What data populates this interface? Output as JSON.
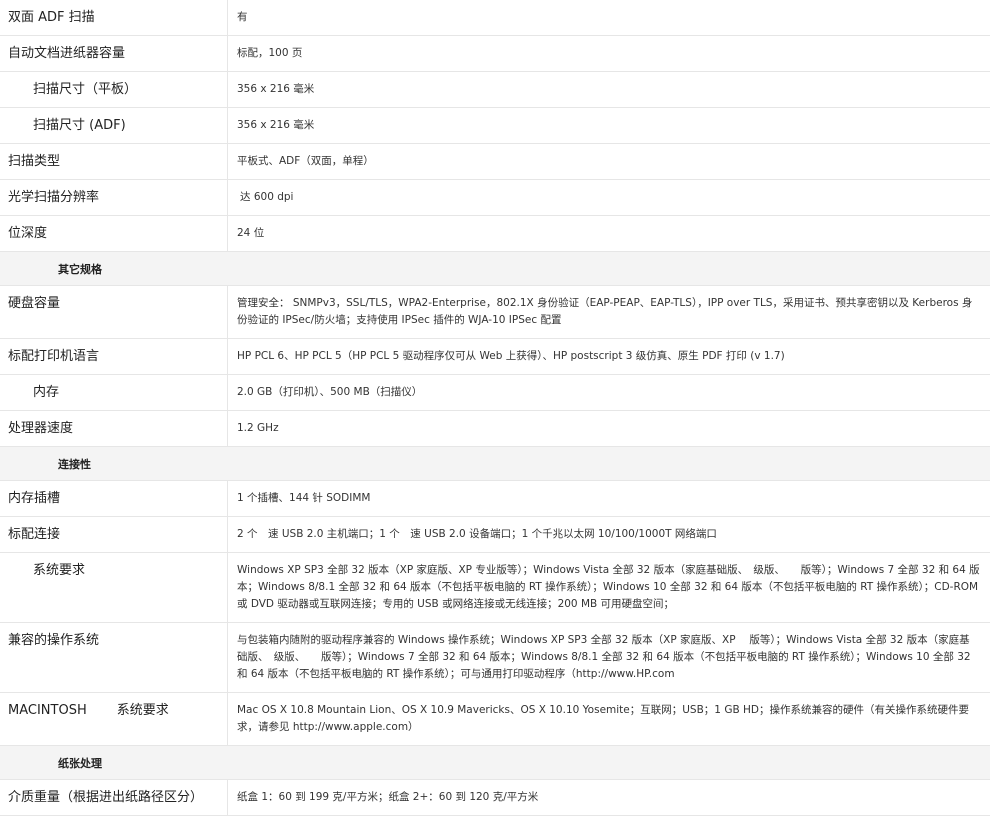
{
  "rows": [
    {
      "type": "spec",
      "label": "双面 ADF 扫描",
      "value": "有"
    },
    {
      "type": "spec",
      "label": "自动文档进纸器容量",
      "value": "标配，100 页"
    },
    {
      "type": "spec",
      "label": "扫描尺寸（平板）",
      "value": "356 x 216 毫米",
      "indent": true
    },
    {
      "type": "spec",
      "label": "扫描尺寸 (ADF)",
      "value": "356 x 216 毫米",
      "indent": true
    },
    {
      "type": "spec",
      "label": "扫描类型",
      "value": "平板式、ADF（双面，单程）"
    },
    {
      "type": "spec",
      "label": "光学扫描分辨率",
      "value": "达 600 dpi",
      "value_indent": true
    },
    {
      "type": "spec",
      "label": "位深度",
      "value": "24 位"
    },
    {
      "type": "section",
      "label": "其它规格"
    },
    {
      "type": "spec",
      "label": "硬盘容量",
      "value": "管理安全： SNMPv3，SSL/TLS，WPA2-Enterprise，802.1X 身份验证（EAP-PEAP、EAP-TLS），IPP over TLS，采用证书、预共享密钥以及 Kerberos 身份验证的 IPSec/防火墙；支持使用 IPSec 插件的 WJA-10 IPSec 配置"
    },
    {
      "type": "spec",
      "label": "标配打印机语言",
      "value": "HP PCL 6、HP PCL 5（HP PCL 5 驱动程序仅可从 Web 上获得）、HP postscript 3 级仿真、原生 PDF 打印 (v 1.7)"
    },
    {
      "type": "spec",
      "label": "内存",
      "value": "2.0 GB（打印机）、500 MB（扫描仪）",
      "indent": true
    },
    {
      "type": "spec",
      "label": "处理器速度",
      "value": "1.2 GHz"
    },
    {
      "type": "section",
      "label": "连接性"
    },
    {
      "type": "spec",
      "label": "内存插槽",
      "value": "1 个插槽、144 针 SODIMM"
    },
    {
      "type": "spec",
      "label": "标配连接",
      "value": "2 个　速 USB 2.0 主机端口；1 个　速 USB 2.0 设备端口；1 个千兆以太网 10/100/1000T 网络端口"
    },
    {
      "type": "spec",
      "label": "系统要求",
      "value": "Windows XP SP3 全部 32 版本（XP 家庭版、XP 专业版等）；Windows Vista 全部 32 版本（家庭基础版、　级版、　　版等）；Windows 7 全部 32 和 64 版本；Windows 8/8.1 全部 32 和 64 版本（不包括平板电脑的 RT 操作系统）；Windows 10 全部 32 和 64 版本（不包括平板电脑的 RT 操作系统）；CD-ROM 或 DVD 驱动器或互联网连接；专用的 USB 或网络连接或无线连接；200 MB 可用硬盘空间；",
      "indent": true
    },
    {
      "type": "spec",
      "label": "兼容的操作系统",
      "value": "与包装箱内随附的驱动程序兼容的 Windows 操作系统；Windows XP SP3 全部 32 版本（XP 家庭版、XP 　版等）；Windows Vista 全部 32 版本（家庭基础版、　级版、　　版等）；Windows 7 全部 32 和 64 版本；Windows 8/8.1 全部 32 和 64 版本（不包括平板电脑的 RT 操作系统）；Windows 10 全部 32 和 64 版本（不包括平板电脑的 RT 操作系统）；可与通用打印驱动程序（http://www.HP.com"
    },
    {
      "type": "spec",
      "label": "MACINTOSH",
      "label_suffix": "系统要求",
      "value": "Mac OS X 10.8 Mountain Lion、OS X 10.9 Mavericks、OS X 10.10 Yosemite；互联网；USB；1 GB HD；操作系统兼容的硬件（有关操作系统硬件要求，请参见 http://www.apple.com）"
    },
    {
      "type": "section",
      "label": "纸张处理"
    },
    {
      "type": "spec",
      "label": "介质重量（根据进出纸路径区分）",
      "value": "纸盒 1：60 到 199 克/平方米；纸盒 2+：60 到 120 克/平方米"
    }
  ]
}
